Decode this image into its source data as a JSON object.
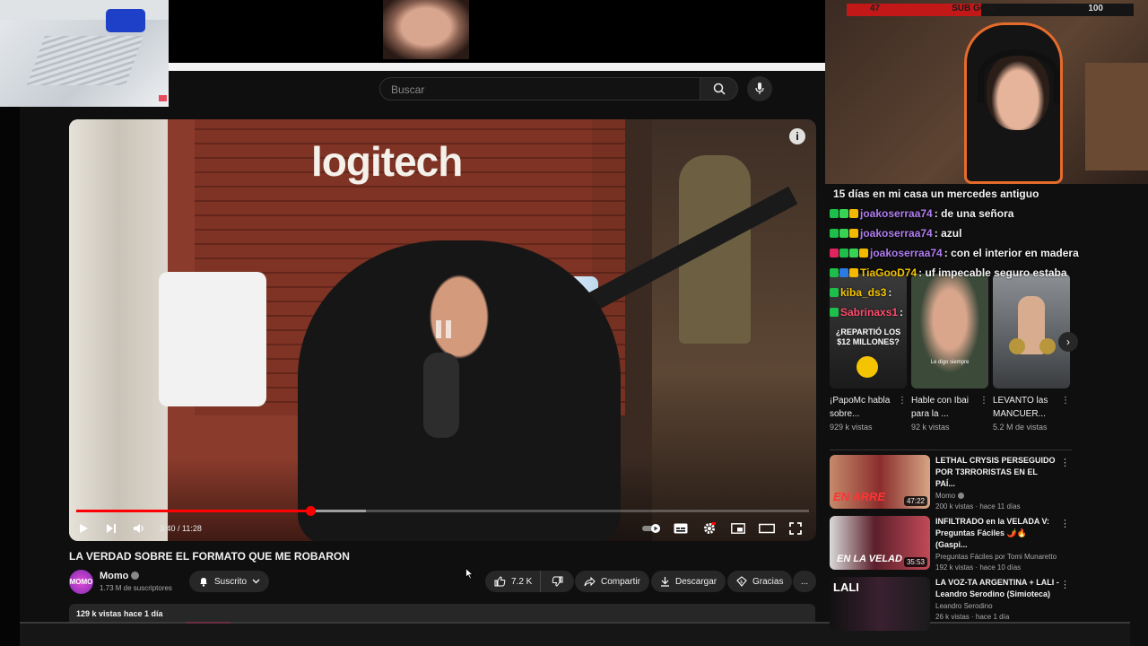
{
  "overlays": {
    "sub_goal": {
      "current": "47",
      "label": "SUB GOAL",
      "target": "100",
      "fill_fraction": 0.47,
      "fill_color": "#c21818"
    }
  },
  "search": {
    "placeholder": "Buscar"
  },
  "player": {
    "time": "3:40 / 11:28",
    "played_fraction": 0.32,
    "buffered_fraction": 0.395,
    "progress_color": "#ff0000",
    "info_label": "i"
  },
  "video": {
    "title": "LA VERDAD SOBRE EL FORMATO QUE ME ROBARON",
    "channel": "Momo",
    "subscribers": "1.73 M de suscriptores",
    "avatar_text": "MOMO",
    "subscribed_label": "Suscrito",
    "likes": "7.2 K",
    "share_label": "Compartir",
    "download_label": "Descargar",
    "thanks_label": "Gracias",
    "more_label": "...",
    "views_date": "129 k vistas  hace 1 día"
  },
  "chat": [
    {
      "user": "",
      "message": "15 días en mi casa un mercedes antiguo",
      "user_color": "#ffffff",
      "badges": []
    },
    {
      "user": "joakoserraa74",
      "message": ": de una señora",
      "user_color": "#b07cf0",
      "badges": [
        "#1dbf4a",
        "#39d353",
        "#f5b800"
      ]
    },
    {
      "user": "joakoserraa74",
      "message": ": azul",
      "user_color": "#b07cf0",
      "badges": [
        "#1dbf4a",
        "#39d353",
        "#f5b800"
      ]
    },
    {
      "user": "joakoserraa74",
      "message": ": con el interior en madera",
      "user_color": "#b07cf0",
      "badges": [
        "#e0245e",
        "#1dbf4a",
        "#39d353",
        "#f5b800"
      ]
    },
    {
      "user": "TiaGooD74",
      "message": ": uf impecable seguro estaba",
      "user_color": "#f5c400",
      "badges": [
        "#1dbf4a",
        "#2c7be5",
        "#f5b800"
      ]
    },
    {
      "user": "kiba_ds3",
      "message": ":",
      "user_color": "#f5c400",
      "badges": [
        "#1dbf4a"
      ]
    },
    {
      "user": "Sabrinaxs1",
      "message": ":",
      "user_color": "#ff4d6d",
      "badges": [
        "#1dbf4a"
      ]
    }
  ],
  "shorts": [
    {
      "title": "¡PapoMc habla sobre...",
      "views": "929 k vistas",
      "thumb_text": "¿REPARTIÓ LOS $12 MILLONES?",
      "color": "#2b2b2b"
    },
    {
      "title": "Hable con Ibai para la ...",
      "views": "92 k vistas",
      "thumb_text": "Le digo siempre",
      "color": "#3c4a3a"
    },
    {
      "title": "LEVANTO las MANCUER...",
      "views": "5.2 M de vistas",
      "thumb_text": "",
      "color": "#6b6f73"
    }
  ],
  "recommended": [
    {
      "title": "LETHAL CRYSIS PERSEGUIDO POR T3RRORISTAS EN EL PAÍ...",
      "channel": "Momo",
      "verified": true,
      "meta": "200 k vistas · hace 11 días",
      "duration": "47:22",
      "thumb_text": "EN ARRE",
      "color": "#8b2d2d"
    },
    {
      "title": "INFILTRADO en la VELADA V: Preguntas Fáciles 🌶️🔥 (Gaspi...",
      "channel": "Preguntas Fáciles por Tomi Munaretto",
      "verified": false,
      "meta": "192 k vistas · hace 10 días",
      "duration": "35:53",
      "thumb_text": "EN LA VELAD",
      "color": "#5b1f2a"
    },
    {
      "title": "LA VOZ-TA ARGENTINA + LALI - Leandro Serodino (Simioteca)",
      "channel": "Leandro Serodino",
      "verified": false,
      "meta": "26 k vistas · hace 1 día",
      "duration": "",
      "thumb_text": "LALI",
      "color": "#3a2030"
    }
  ]
}
